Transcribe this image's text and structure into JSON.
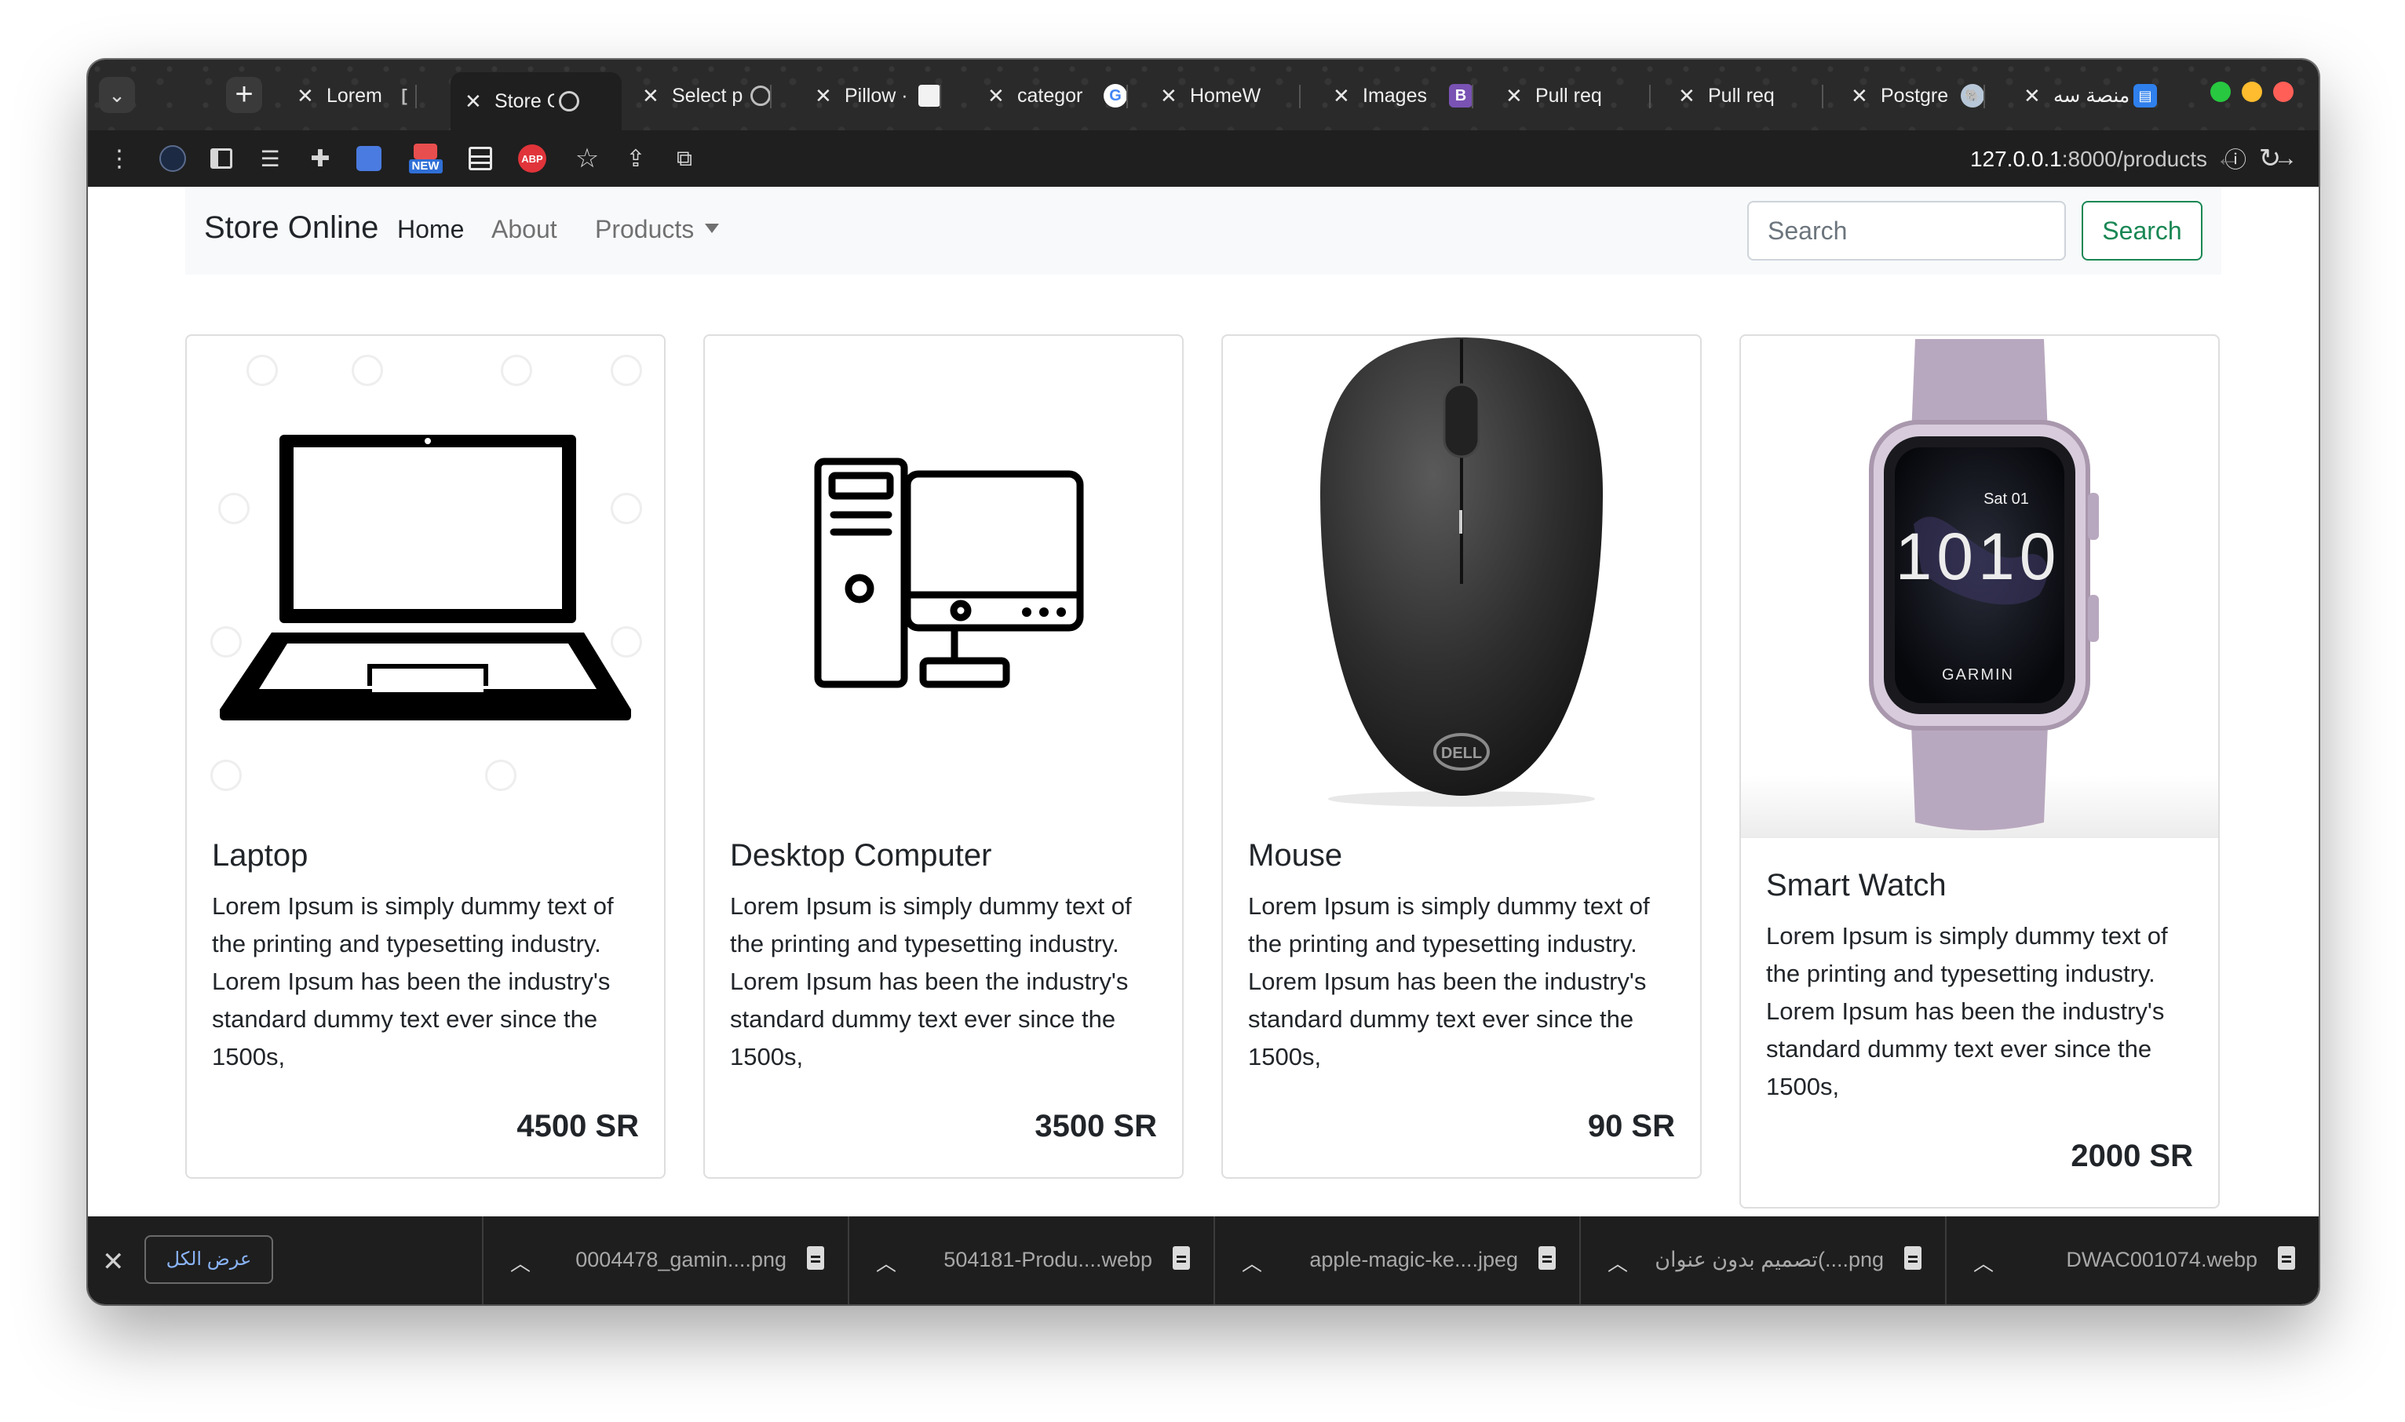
{
  "browser": {
    "tabs": [
      {
        "title": "Lorem I",
        "favicon": "doc-icon"
      },
      {
        "title": "Store O",
        "favicon": "globe-icon",
        "active": true
      },
      {
        "title": "Select p",
        "favicon": "globe-icon"
      },
      {
        "title": "Pillow ·",
        "favicon": "cube-icon"
      },
      {
        "title": "categor",
        "favicon": "google-icon"
      },
      {
        "title": "HomeW",
        "favicon": "github-icon"
      },
      {
        "title": "Images",
        "favicon": "bootstrap-icon"
      },
      {
        "title": "Pull req",
        "favicon": "github-icon"
      },
      {
        "title": "Pull req",
        "favicon": "github-icon"
      },
      {
        "title": "Postgre",
        "favicon": "postgres-icon"
      },
      {
        "title": "منصة سه",
        "favicon": "app-icon"
      }
    ],
    "url_host": "127.0.0.1",
    "url_rest": ":8000/products",
    "extension_badge_new": "NEW",
    "extension_badge_abp": "ABP"
  },
  "navbar": {
    "brand": "Store Online",
    "links": [
      "Home",
      "About",
      "Products"
    ],
    "search_placeholder": "Search",
    "search_button": "Search"
  },
  "products": [
    {
      "name": "Laptop",
      "description": "Lorem Ipsum is simply dummy text of the printing and typesetting industry. Lorem Ipsum has been the industry's standard dummy text ever since the 1500s,",
      "price": "4500 SR",
      "image": "laptop-icon"
    },
    {
      "name": "Desktop Computer",
      "description": "Lorem Ipsum is simply dummy text of the printing and typesetting industry. Lorem Ipsum has been the industry's standard dummy text ever since the 1500s,",
      "price": "3500 SR",
      "image": "desktop-computer-icon"
    },
    {
      "name": "Mouse",
      "description": "Lorem Ipsum is simply dummy text of the printing and typesetting industry. Lorem Ipsum has been the industry's standard dummy text ever since the 1500s,",
      "price": "90 SR",
      "image": "mouse-photo",
      "brand_mark": "DELL"
    },
    {
      "name": "Smart Watch",
      "description": "Lorem Ipsum is simply dummy text of the printing and typesetting industry. Lorem Ipsum has been the industry's standard dummy text ever since the 1500s,",
      "price": "2000 SR",
      "image": "smartwatch-photo",
      "watch_date": "Sat 01",
      "watch_time": "1010",
      "watch_brand": "GARMIN"
    }
  ],
  "downloads": {
    "show_all": "عرض الكل",
    "items": [
      "0004478_gamin....png",
      "504181-Produ....webp",
      "apple-magic-ke....jpeg",
      "تصميم بدون عنوان(....png",
      "DWAC001074.webp"
    ]
  },
  "colors": {
    "accent_green": "#198754",
    "navbar_bg": "#f8f9fa",
    "chrome_dark": "#1f1f1f"
  }
}
